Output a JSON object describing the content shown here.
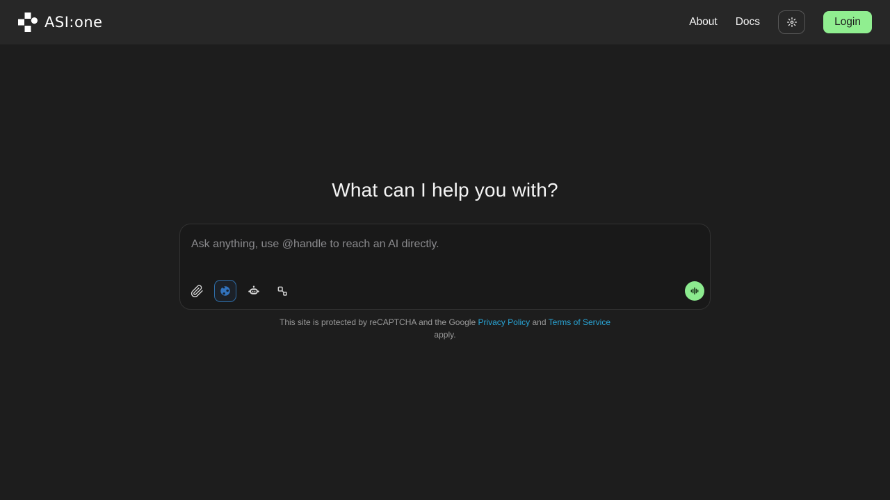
{
  "header": {
    "logo": {
      "wordmark": "ASI:one"
    },
    "nav_items": [
      {
        "label": "About"
      },
      {
        "label": "Docs"
      }
    ],
    "theme_toggle_icon": "sun-icon",
    "login_button": {
      "label": "Login"
    }
  },
  "main": {
    "heading": "What can I help you with?",
    "composer": {
      "placeholder": "Ask anything, use @handle to reach an AI directly.",
      "tools": [
        {
          "name": "attach",
          "icon": "paperclip-icon",
          "active": false
        },
        {
          "name": "web-search",
          "icon": "globe-icon",
          "active": true
        },
        {
          "name": "agents",
          "icon": "robot-icon",
          "active": false
        },
        {
          "name": "connections",
          "icon": "nodes-icon",
          "active": false
        }
      ],
      "voice_button_icon": "waveform-icon"
    },
    "recaptcha_notice": {
      "text_before": "This site is protected by reCAPTCHA and the Google ",
      "privacy_policy_label": "Privacy Policy",
      "text_between": " and ",
      "terms_label": "Terms of Service",
      "text_after": " apply."
    }
  },
  "colors": {
    "page_bg": "#1d1d1d",
    "header_bg": "#272727",
    "accent_green": "#90ee90",
    "globe_blue": "#3273bd",
    "link_blue": "#29a5d6"
  }
}
